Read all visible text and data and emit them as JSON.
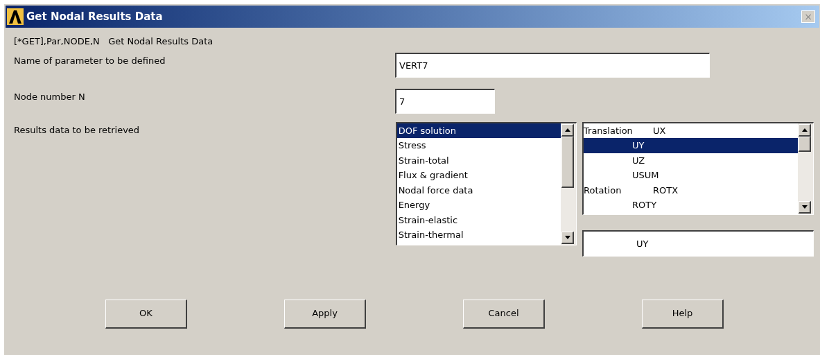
{
  "window": {
    "title": "Get Nodal Results Data",
    "close": "×"
  },
  "command": "[*GET],Par,NODE,N   Get Nodal Results Data",
  "fields": [
    {
      "label": "Name of parameter to be defined",
      "value": "VERT7",
      "kind": "wide"
    },
    {
      "label": "Node number N",
      "value": "7",
      "kind": "narrow"
    }
  ],
  "results": {
    "label": "Results data to be retrieved",
    "categories": [
      {
        "label": "DOF solution",
        "selected": true
      },
      {
        "label": "Stress",
        "selected": false
      },
      {
        "label": "Strain-total",
        "selected": false
      },
      {
        "label": "Flux & gradient",
        "selected": false
      },
      {
        "label": "Nodal force data",
        "selected": false
      },
      {
        "label": "Energy",
        "selected": false
      },
      {
        "label": "Strain-elastic",
        "selected": false
      },
      {
        "label": "Strain-thermal",
        "selected": false
      }
    ],
    "items": [
      {
        "group": "Translation",
        "label": "UX",
        "selected": false
      },
      {
        "label": "UY",
        "selected": true
      },
      {
        "label": "UZ",
        "selected": false
      },
      {
        "label": "USUM",
        "selected": false
      },
      {
        "group": "Rotation",
        "label": "ROTX",
        "selected": false
      },
      {
        "label": "ROTY",
        "selected": false
      }
    ],
    "choice": "UY"
  },
  "buttons": [
    "OK",
    "Apply",
    "Cancel",
    "Help"
  ]
}
